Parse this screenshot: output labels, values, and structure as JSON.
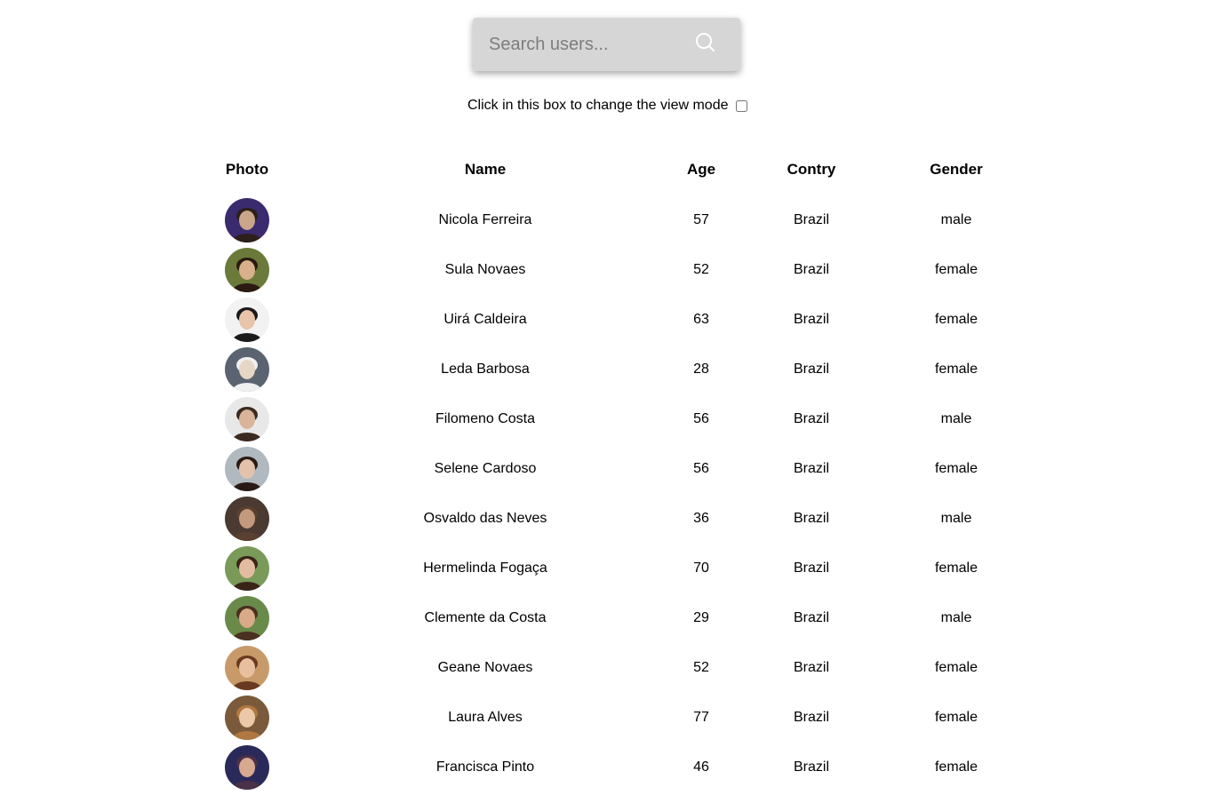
{
  "search": {
    "placeholder": "Search users..."
  },
  "view_mode": {
    "label": "Click in this box to change the view mode",
    "checked": false
  },
  "table": {
    "headers": {
      "photo": "Photo",
      "name": "Name",
      "age": "Age",
      "country": "Contry",
      "gender": "Gender"
    },
    "rows": [
      {
        "name": "Nicola Ferreira",
        "age": "57",
        "country": "Brazil",
        "gender": "male",
        "avatar_colors": [
          "#3a2a6e",
          "#c9a58a",
          "#2d1f1a"
        ]
      },
      {
        "name": "Sula Novaes",
        "age": "52",
        "country": "Brazil",
        "gender": "female",
        "avatar_colors": [
          "#6b7a3a",
          "#d9b08c",
          "#2a1a12"
        ]
      },
      {
        "name": "Uirá Caldeira",
        "age": "63",
        "country": "Brazil",
        "gender": "female",
        "avatar_colors": [
          "#f2f2f2",
          "#e8c4aa",
          "#1a1a1a"
        ]
      },
      {
        "name": "Leda Barbosa",
        "age": "28",
        "country": "Brazil",
        "gender": "female",
        "avatar_colors": [
          "#5a6470",
          "#e6d6c6",
          "#f0f0f0"
        ]
      },
      {
        "name": "Filomeno Costa",
        "age": "56",
        "country": "Brazil",
        "gender": "male",
        "avatar_colors": [
          "#e8e8e8",
          "#d8b49a",
          "#3a2a20"
        ]
      },
      {
        "name": "Selene Cardoso",
        "age": "56",
        "country": "Brazil",
        "gender": "female",
        "avatar_colors": [
          "#b0b8c0",
          "#e2c2ac",
          "#2a1a14"
        ]
      },
      {
        "name": "Osvaldo das Neves",
        "age": "36",
        "country": "Brazil",
        "gender": "male",
        "avatar_colors": [
          "#4a3a32",
          "#c49a7e",
          "#5a4030"
        ]
      },
      {
        "name": "Hermelinda Fogaça",
        "age": "70",
        "country": "Brazil",
        "gender": "female",
        "avatar_colors": [
          "#7a9a5a",
          "#e2bca0",
          "#3a2418"
        ]
      },
      {
        "name": "Clemente da Costa",
        "age": "29",
        "country": "Brazil",
        "gender": "male",
        "avatar_colors": [
          "#6a8a4a",
          "#d8aa88",
          "#4a3020"
        ]
      },
      {
        "name": "Geane Novaes",
        "age": "52",
        "country": "Brazil",
        "gender": "female",
        "avatar_colors": [
          "#c89a6a",
          "#e8c0a0",
          "#6a3a20"
        ]
      },
      {
        "name": "Laura Alves",
        "age": "77",
        "country": "Brazil",
        "gender": "female",
        "avatar_colors": [
          "#7a5a3a",
          "#ecc8a8",
          "#b07840"
        ]
      },
      {
        "name": "Francisca Pinto",
        "age": "46",
        "country": "Brazil",
        "gender": "female",
        "avatar_colors": [
          "#2a2a5a",
          "#d8a890",
          "#4a3048"
        ]
      }
    ]
  }
}
